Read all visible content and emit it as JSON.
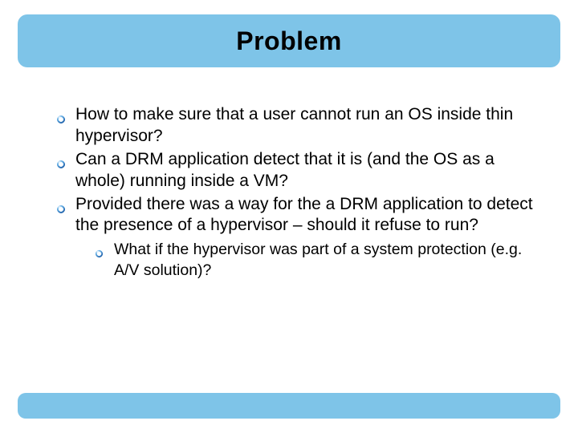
{
  "title": "Problem",
  "bullets": [
    {
      "text": "How to make sure that a user cannot run an OS inside thin hypervisor?"
    },
    {
      "text": "Can a DRM application detect that it is (and the OS as a whole) running inside a VM?"
    },
    {
      "text": "Provided there was a way for the a DRM application to detect the presence of a hypervisor – should it refuse to run?",
      "sub": [
        {
          "text": "What if the hypervisor was part of a system protection (e.g. A/V solution)?"
        }
      ]
    }
  ],
  "colors": {
    "bar": "#7ec4e8",
    "bullet_fill": "#4a8fd6",
    "bullet_highlight": "#bfe4fb"
  }
}
